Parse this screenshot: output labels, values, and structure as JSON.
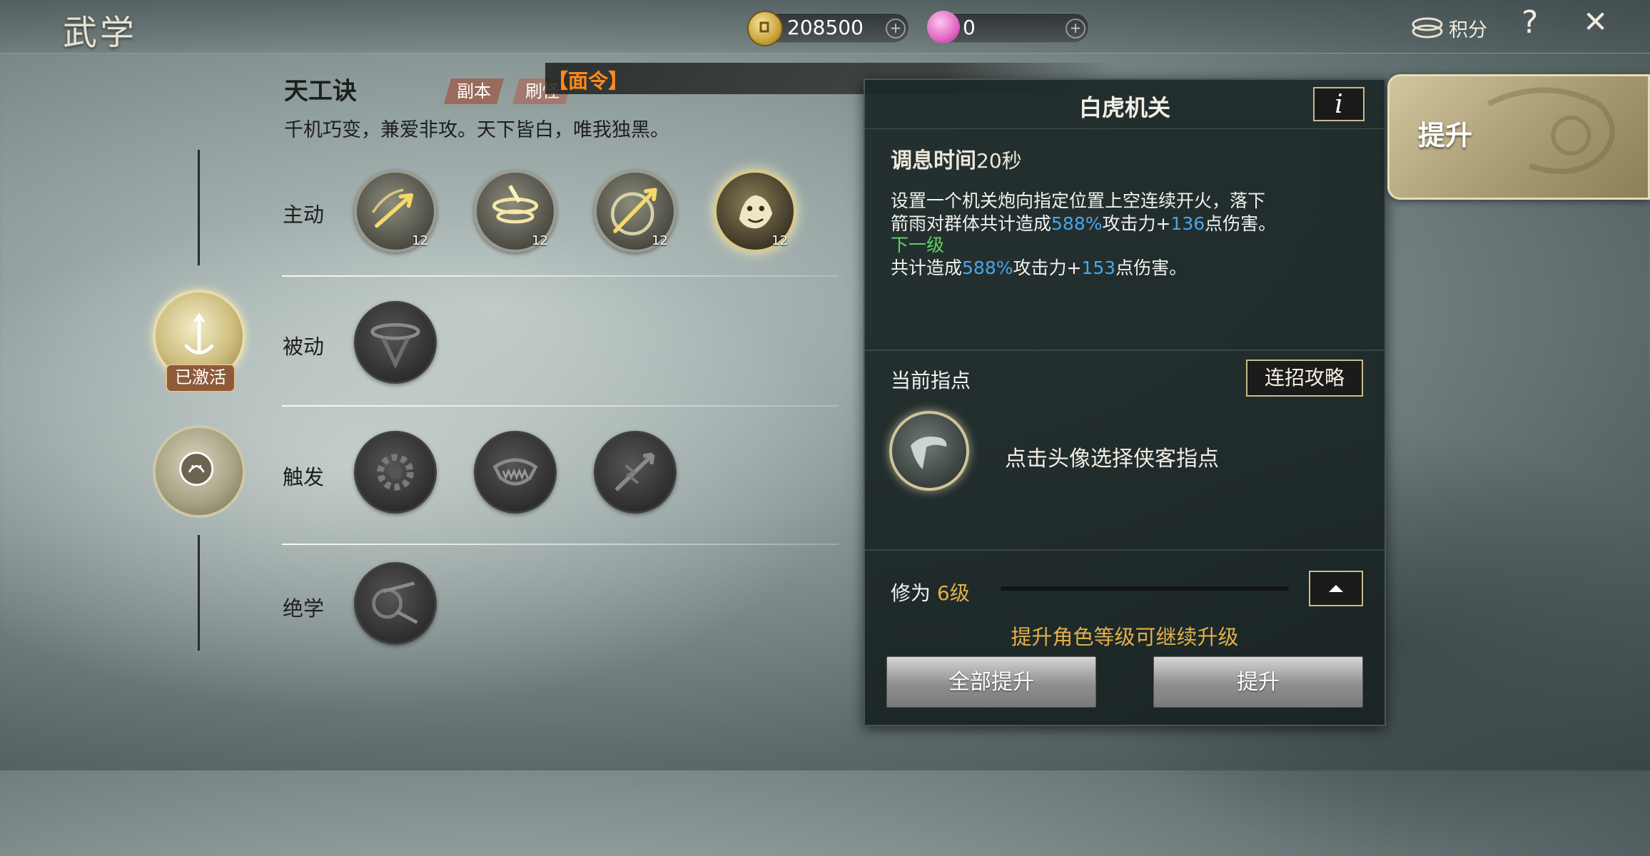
{
  "header": {
    "title": "武学",
    "coins": "208500",
    "gems": "0",
    "points_label": "积分",
    "help_label": "?",
    "close_label": "✕"
  },
  "skill_tree": {
    "name": "天工诀",
    "tags": [
      "副本",
      "刷怪"
    ],
    "order_banner": "【面令】",
    "motto": "千机巧变，兼爱非攻。天下皆白，唯我独黑。",
    "rows": [
      {
        "label": "主动",
        "skills": [
          {
            "level": "12"
          },
          {
            "level": "12"
          },
          {
            "level": "12"
          },
          {
            "level": "12"
          }
        ]
      },
      {
        "label": "被动"
      },
      {
        "label": "触发"
      },
      {
        "label": "绝学"
      }
    ],
    "activated_badge": "已激活"
  },
  "detail_panel": {
    "title": "白虎机关",
    "info_button": "i",
    "cooldown_label": "调息时间",
    "cooldown_value": "20秒",
    "desc_line1": "设置一个机关炮向指定位置上空连续开火，落下",
    "desc_line2_pre": "箭雨对群体共计造成",
    "desc_line2_pct": "588%",
    "desc_line2_mid": "攻击力+",
    "desc_line2_val": "136",
    "desc_line2_post": "点伤害。",
    "next_level_label": "下一级",
    "next_pre": "共计造成",
    "next_pct": "588%",
    "next_mid": "攻击力+",
    "next_val": "153",
    "next_post": "点伤害。",
    "guidance_label": "当前指点",
    "combo_button": "连招攻略",
    "guidance_hint": "点击头像选择侠客指点",
    "cultivation_label": "修为",
    "cultivation_value": "6级",
    "cultivation_progress": 0,
    "upgrade_hint": "提升角色等级可继续升级",
    "upgrade_all_button": "全部提升",
    "upgrade_button": "提升"
  },
  "side_tab": {
    "label": "提升"
  },
  "colors": {
    "accent_gold": "#e0b04a",
    "blue_value": "#4aa6e8",
    "green_label": "#5cd463",
    "order_orange": "#ff8a1a"
  }
}
